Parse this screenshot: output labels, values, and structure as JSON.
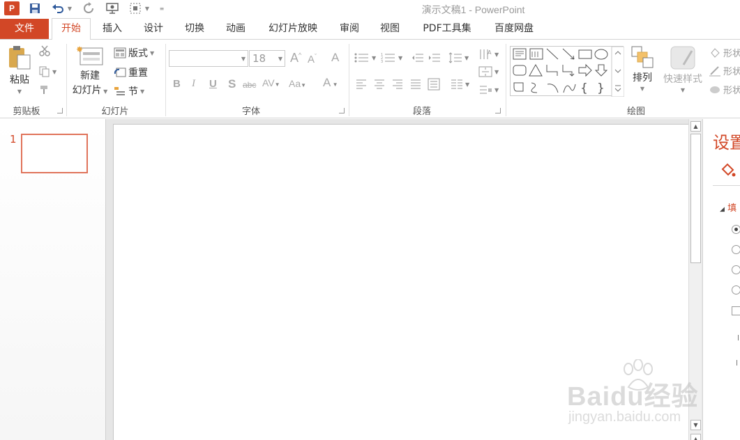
{
  "window": {
    "title": "演示文稿1 - PowerPoint",
    "logo_letter": "P"
  },
  "tabs": [
    {
      "label": "文件"
    },
    {
      "label": "开始"
    },
    {
      "label": "插入"
    },
    {
      "label": "设计"
    },
    {
      "label": "切换"
    },
    {
      "label": "动画"
    },
    {
      "label": "幻灯片放映"
    },
    {
      "label": "审阅"
    },
    {
      "label": "视图"
    },
    {
      "label": "PDF工具集"
    },
    {
      "label": "百度网盘"
    }
  ],
  "ribbon": {
    "clipboard": {
      "paste_label": "粘贴",
      "group_label": "剪贴板"
    },
    "slides": {
      "new_slide_label_line1": "新建",
      "new_slide_label_line2": "幻灯片",
      "layout_label": "版式",
      "reset_label": "重置",
      "section_label": "节",
      "group_label": "幻灯片"
    },
    "font": {
      "font_name": "",
      "font_size": "18",
      "group_label": "字体"
    },
    "paragraph": {
      "group_label": "段落"
    },
    "drawing": {
      "arrange_label": "排列",
      "quick_styles_label": "快速样式",
      "shape_fill_label": "形状",
      "shape_outline_label": "形状",
      "shape_effects_label": "形状",
      "group_label": "绘图"
    }
  },
  "thumbnails": {
    "slide_number": "1"
  },
  "format_pane": {
    "title": "设置",
    "section_label": "填"
  },
  "watermark": {
    "brand": "Baidu经验",
    "url": "jingyan.baidu.com"
  },
  "colors": {
    "accent": "#d24726",
    "thumb_border": "#e0735a"
  }
}
